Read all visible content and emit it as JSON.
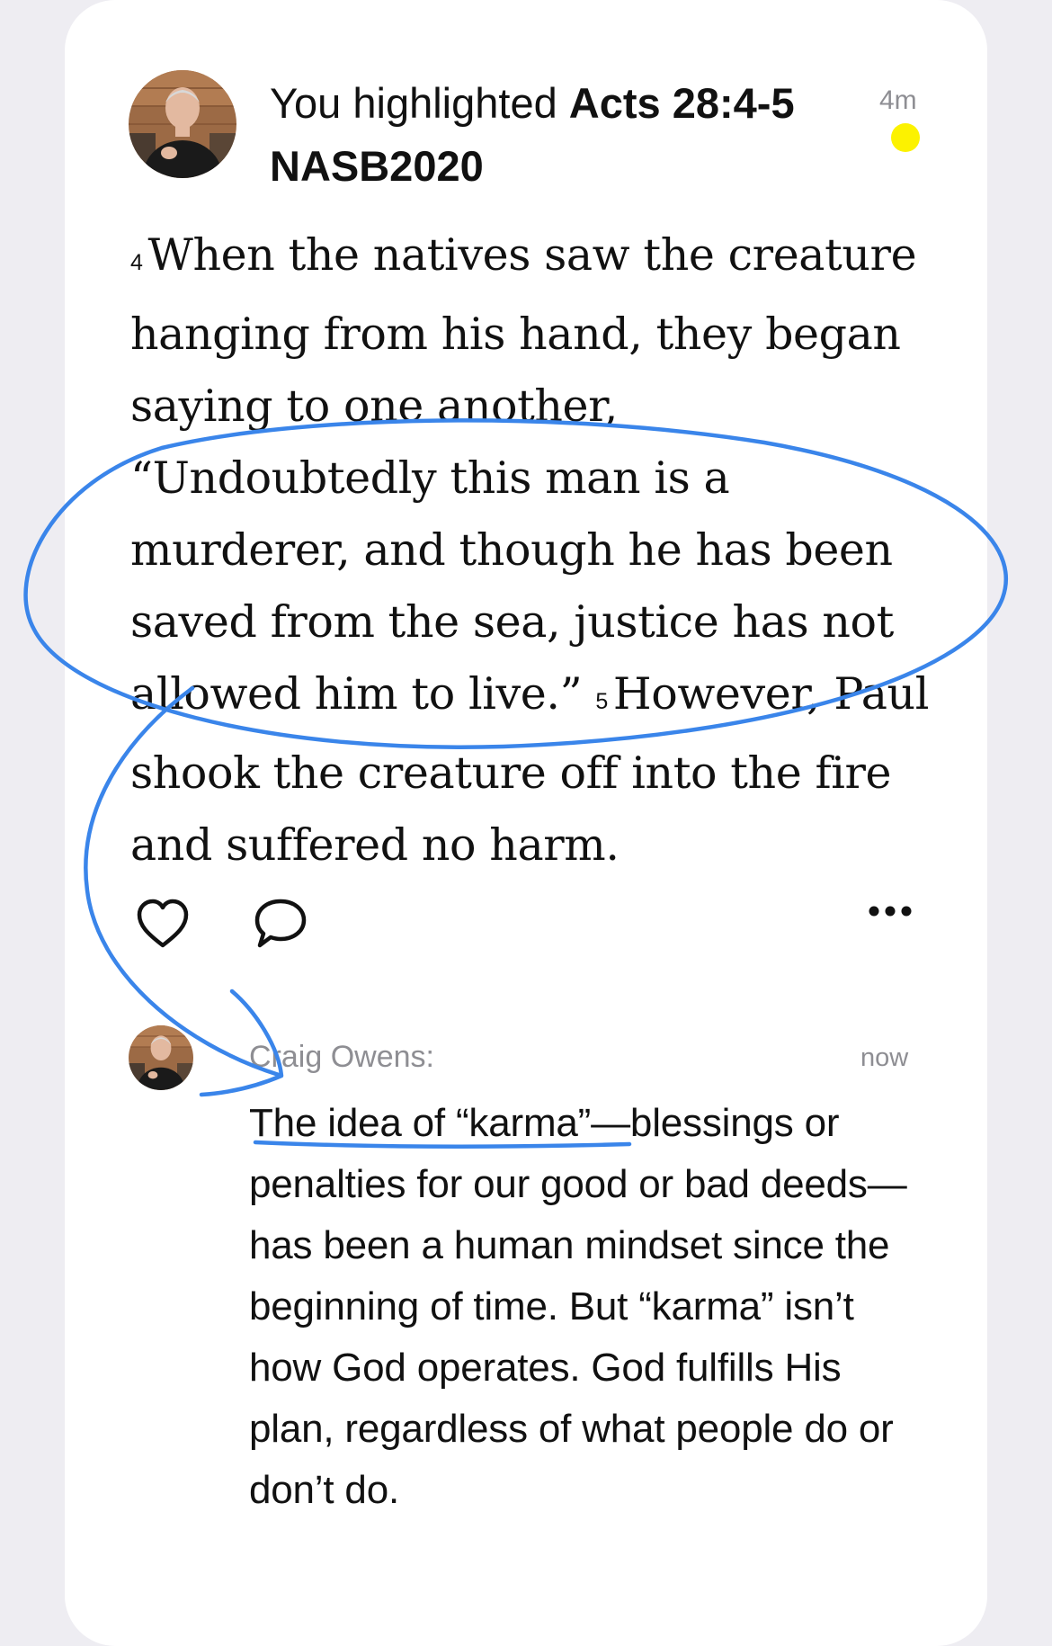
{
  "post": {
    "headline_prefix": "You highlighted ",
    "reference": "Acts 28:4-5",
    "version": "NASB2020",
    "time": "4m",
    "verses": [
      {
        "num": "4",
        "text": "When the natives saw the creature hanging from his hand, they began saying to one another, “Undoubtedly this man is a murderer, and though he has been saved from the sea, justice has not allowed him to live.” "
      },
      {
        "num": "5",
        "text": "However, Paul shook the creature off into the fire and suffered no harm."
      }
    ]
  },
  "actions": {
    "like_icon": "heart-outline-icon",
    "comment_icon": "speech-bubble-icon",
    "more_icon": "ellipsis-icon"
  },
  "comment": {
    "author": "Craig Owens:",
    "time": "now",
    "text": "The idea of “karma”—blessings or penalties for our good or bad deeds—has been a human mindset since the beginning of time. But “karma” isn’t how God operates. God fulfills His plan, regardless of what people do or don’t do."
  },
  "colors": {
    "annotation": "#3a85ea",
    "unread_dot": "#fcf200",
    "meta_gray": "#8e8e93"
  }
}
